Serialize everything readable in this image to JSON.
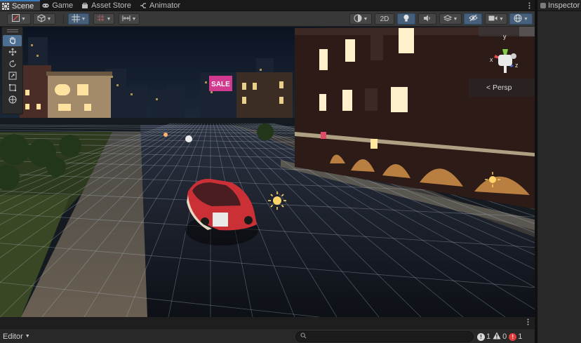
{
  "tabs": [
    {
      "label": "Scene",
      "icon": "scene-tab-icon",
      "active": true
    },
    {
      "label": "Game",
      "icon": "game-tab-icon",
      "active": false
    },
    {
      "label": "Asset Store",
      "icon": "store-tab-icon",
      "active": false
    },
    {
      "label": "Animator",
      "icon": "animator-tab-icon",
      "active": false
    }
  ],
  "toolbar": {
    "mode_2d_label": "2D"
  },
  "scene": {
    "billboard_text": "SALE",
    "view_mode_label": "< Persp",
    "gizmo_axes": {
      "y": "y",
      "x": "x",
      "z": "z"
    }
  },
  "inspector": {
    "title": "Inspector"
  },
  "console": {
    "editor_label": "Editor",
    "search_placeholder": "",
    "info_count": "1",
    "warning_count": "0",
    "error_count": "1"
  },
  "colors": {
    "accent": "#3a79bb",
    "tool_active": "#4d6f92",
    "toggle_active": "#46607c",
    "error": "#e03c3c"
  }
}
